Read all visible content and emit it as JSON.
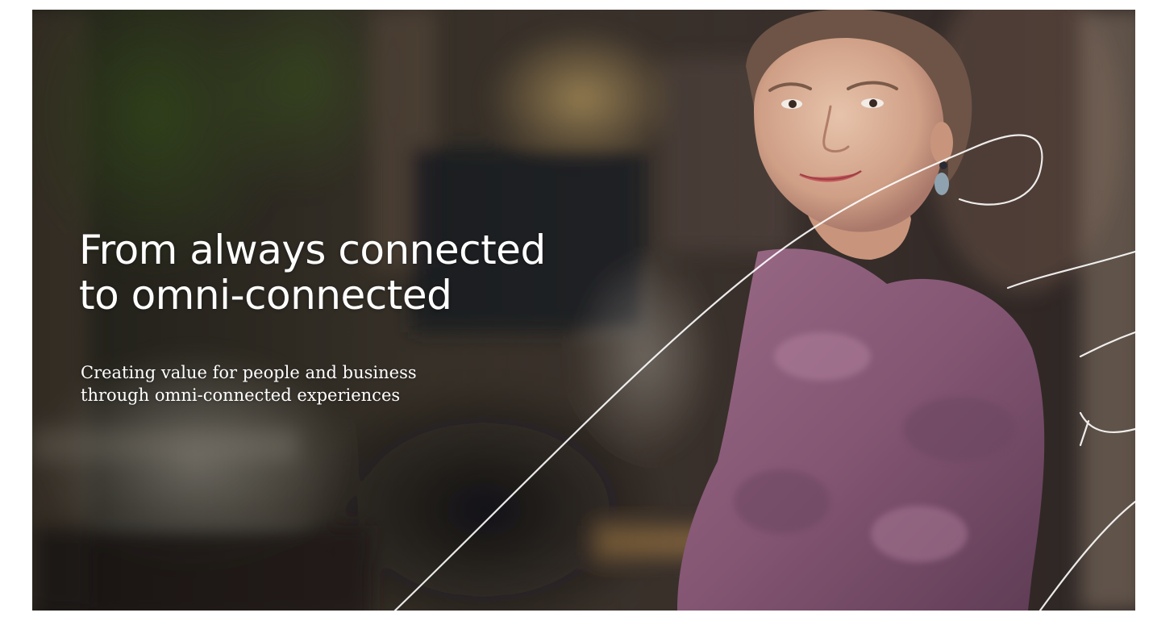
{
  "hero": {
    "headline_line1": "From always connected",
    "headline_line2": "to omni-connected",
    "subline_line1": "Creating value for people and business",
    "subline_line2": "through omni-connected experiences"
  },
  "photo": {
    "description_icon": "portrait-photo",
    "sweater_color": "#8a5a78",
    "line_color": "#ffffff"
  }
}
